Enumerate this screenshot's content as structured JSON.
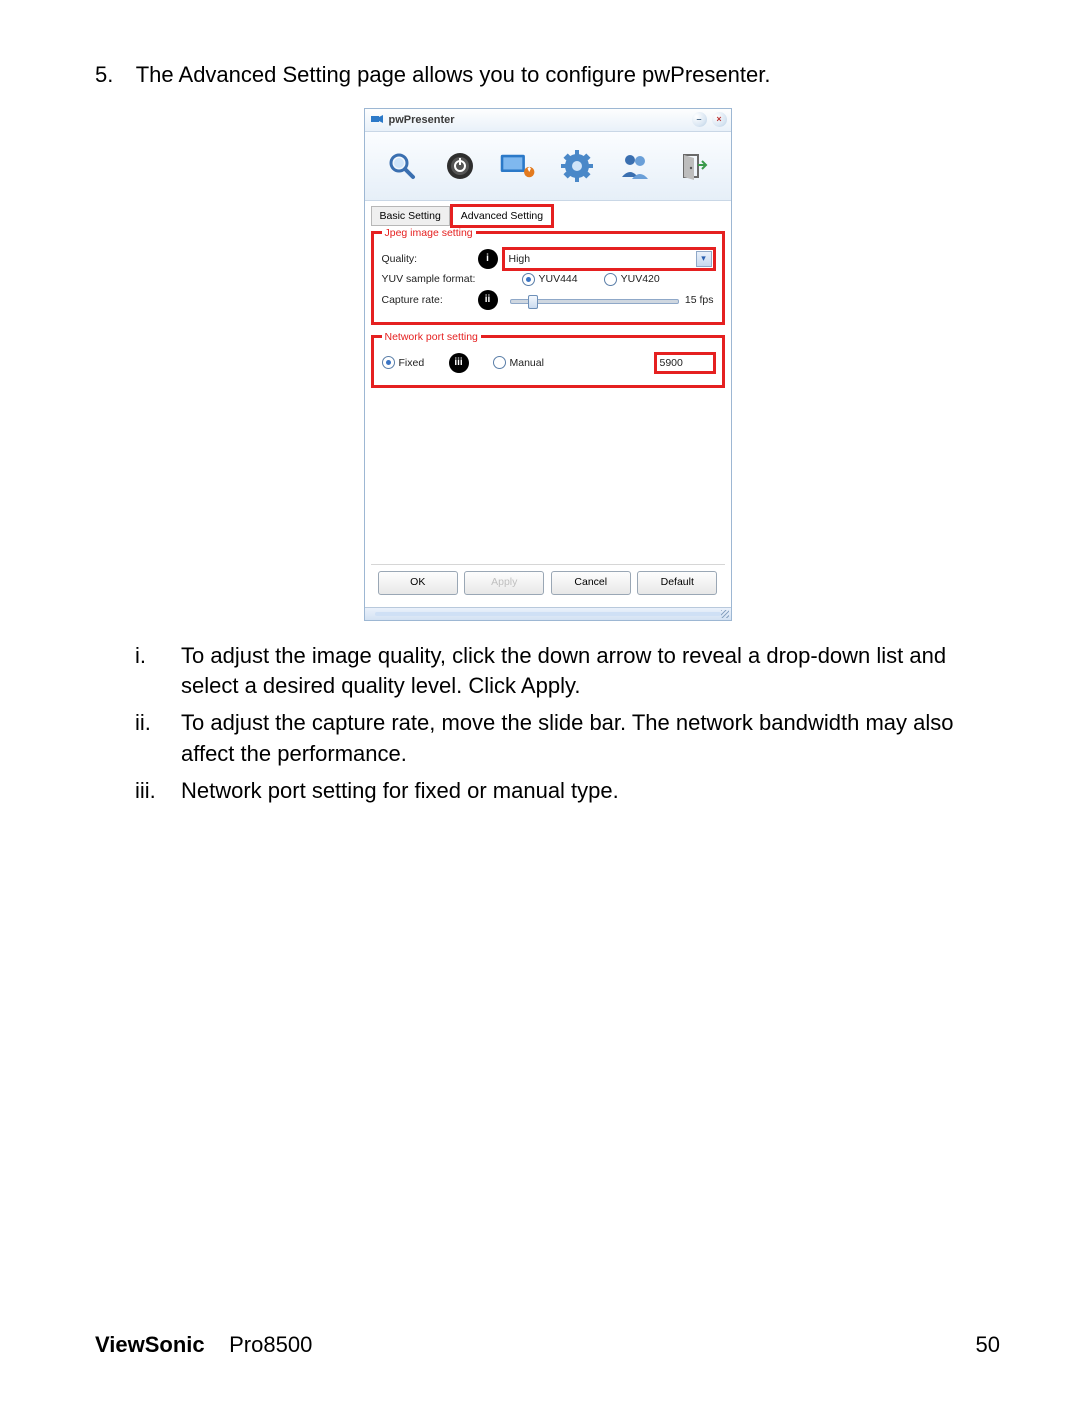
{
  "intro_num": "5.",
  "intro_text": "The Advanced Setting page allows you to configure pwPresenter.",
  "window": {
    "title": "pwPresenter",
    "min": "–",
    "close": "×"
  },
  "toolbar_icons": [
    "search",
    "power",
    "display",
    "gear",
    "users",
    "door"
  ],
  "tabs": {
    "basic": "Basic Setting",
    "advanced": "Advanced Setting"
  },
  "jpeg": {
    "legend": "Jpeg image setting",
    "quality_label": "Quality:",
    "quality_value": "High",
    "sample_label": "YUV sample format:",
    "yuv444": "YUV444",
    "yuv420": "YUV420",
    "capture_label": "Capture rate:",
    "capture_value": "15 fps"
  },
  "net": {
    "legend": "Network port setting",
    "fixed": "Fixed",
    "manual": "Manual",
    "port": "5900"
  },
  "callouts": {
    "i": "i",
    "ii": "ii",
    "iii": "iii"
  },
  "buttons": {
    "ok": "OK",
    "apply": "Apply",
    "cancel": "Cancel",
    "default": "Default"
  },
  "list": {
    "i_num": "i.",
    "i_text": "To adjust the image quality, click the down arrow to reveal a drop-down list and select a desired quality level. Click Apply.",
    "ii_num": "ii.",
    "ii_text": "To adjust the capture rate, move the slide bar. The network bandwidth may also affect the performance.",
    "iii_num": "iii.",
    "iii_text": "Network port setting for fixed or manual type."
  },
  "footer": {
    "brand": "ViewSonic",
    "model": "Pro8500",
    "page": "50"
  }
}
